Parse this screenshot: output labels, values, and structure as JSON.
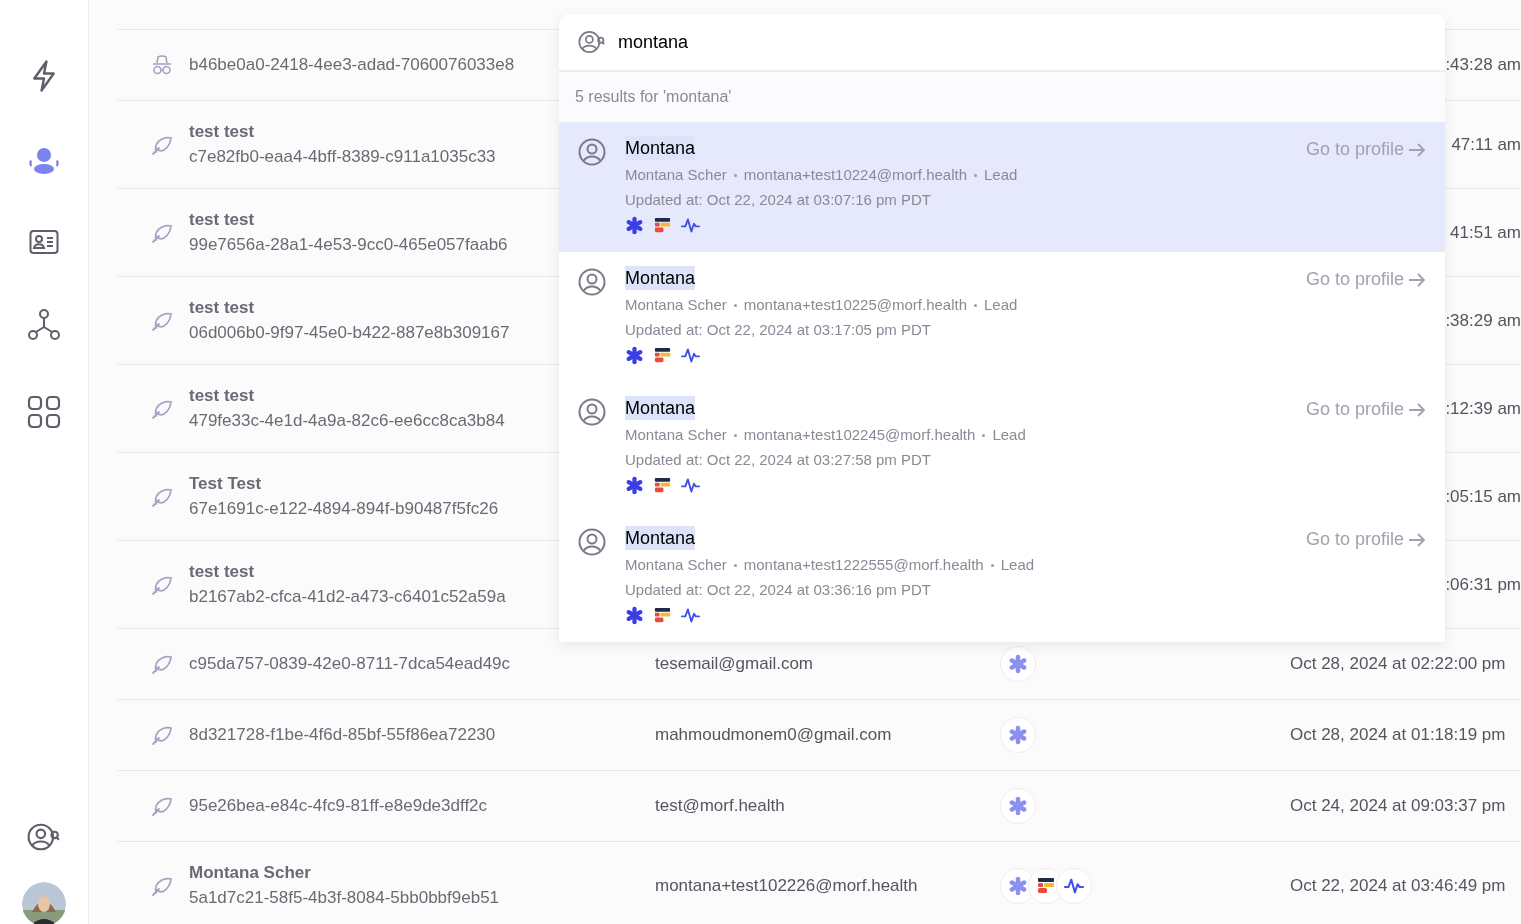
{
  "sidebar": {
    "nav": [
      {
        "selected": false
      },
      {
        "selected": true
      },
      {
        "selected": false
      },
      {
        "selected": false
      },
      {
        "selected": false
      }
    ]
  },
  "table": {
    "rows": [
      {
        "kind": "guest",
        "id": "b46be0a0-2418-4ee3-adad-7060076033e8",
        "updated": ":43:28 am",
        "cut": true
      },
      {
        "kind": "contact",
        "name": "test test",
        "id": "c7e82fb0-eaa4-4bff-8389-c911a1035c33",
        "updated": "47:11 am",
        "cut": true
      },
      {
        "kind": "contact",
        "name": "test test",
        "id": "99e7656a-28a1-4e53-9cc0-465e057faab6",
        "updated": "41:51 am",
        "cut": true
      },
      {
        "kind": "contact",
        "name": "test test",
        "id": "06d006b0-9f97-45e0-b422-887e8b309167",
        "updated": ":38:29 am",
        "cut": true
      },
      {
        "kind": "contact",
        "name": "test test",
        "id": "479fe33c-4e1d-4a9a-82c6-ee6cc8ca3b84",
        "updated": ":12:39 am",
        "cut": true
      },
      {
        "kind": "contact",
        "name": "Test Test",
        "id": "67e1691c-e122-4894-894f-b90487f5fc26",
        "updated": ":05:15 am",
        "cut": true
      },
      {
        "kind": "contact",
        "name": "test test",
        "id": "b2167ab2-cfca-41d2-a473-c6401c52a59a",
        "updated": ":06:31 pm",
        "cut": true
      },
      {
        "kind": "contact",
        "id": "c95da757-0839-42e0-8711-7dca54ead49c",
        "email": "tesemail@gmail.com",
        "sources": [
          {
            "kind": "asterisk"
          }
        ],
        "updated": "Oct 28, 2024 at 02:22:00 pm",
        "cut": false
      },
      {
        "kind": "contact",
        "id": "8d321728-f1be-4f6d-85bf-55f86ea72230",
        "email": "mahmoudmonem0@gmail.com",
        "sources": [
          {
            "kind": "asterisk"
          }
        ],
        "updated": "Oct 28, 2024 at 01:18:19 pm",
        "cut": false
      },
      {
        "kind": "contact",
        "id": "95e26bea-e84c-4fc9-81ff-e8e9de3dff2c",
        "email": "test@morf.health",
        "sources": [
          {
            "kind": "asterisk"
          }
        ],
        "updated": "Oct 24, 2024 at 09:03:37 pm",
        "cut": false
      },
      {
        "kind": "contact",
        "name": "Montana Scher",
        "id": "5a1d7c21-58f5-4b3f-8084-5bb0bbf9eb51",
        "email": "montana+test102226@morf.health",
        "sources": [
          {
            "kind": "asterisk"
          },
          {
            "kind": "bars"
          },
          {
            "kind": "wave"
          }
        ],
        "updated": "Oct 22, 2024 at 03:46:49 pm",
        "cut": false
      }
    ]
  },
  "search": {
    "value": "montana",
    "summary": "5 results for 'montana'",
    "results": [
      {
        "selected": true,
        "name": "Montana",
        "details": [
          "Montana Scher",
          "montana+test10224@morf.health",
          "Lead"
        ],
        "updated": "Updated at: Oct 22, 2024 at 03:07:16 pm PDT",
        "sources": [
          {
            "kind": "asterisk"
          },
          {
            "kind": "bars"
          },
          {
            "kind": "wave"
          }
        ],
        "action": "Go to profile"
      },
      {
        "selected": false,
        "name": "Montana",
        "details": [
          "Montana Scher",
          "montana+test10225@morf.health",
          "Lead"
        ],
        "updated": "Updated at: Oct 22, 2024 at 03:17:05 pm PDT",
        "sources": [
          {
            "kind": "asterisk"
          },
          {
            "kind": "bars"
          },
          {
            "kind": "wave"
          }
        ],
        "action": "Go to profile"
      },
      {
        "selected": false,
        "name": "Montana",
        "details": [
          "Montana Scher",
          "montana+test102245@morf.health",
          "Lead"
        ],
        "updated": "Updated at: Oct 22, 2024 at 03:27:58 pm PDT",
        "sources": [
          {
            "kind": "asterisk"
          },
          {
            "kind": "bars"
          },
          {
            "kind": "wave"
          }
        ],
        "action": "Go to profile"
      },
      {
        "selected": false,
        "name": "Montana",
        "details": [
          "Montana Scher",
          "montana+test1222555@morf.health",
          "Lead"
        ],
        "updated": "Updated at: Oct 22, 2024 at 03:36:16 pm PDT",
        "sources": [
          {
            "kind": "asterisk"
          },
          {
            "kind": "bars"
          },
          {
            "kind": "wave"
          }
        ],
        "action": "Go to profile"
      }
    ]
  }
}
